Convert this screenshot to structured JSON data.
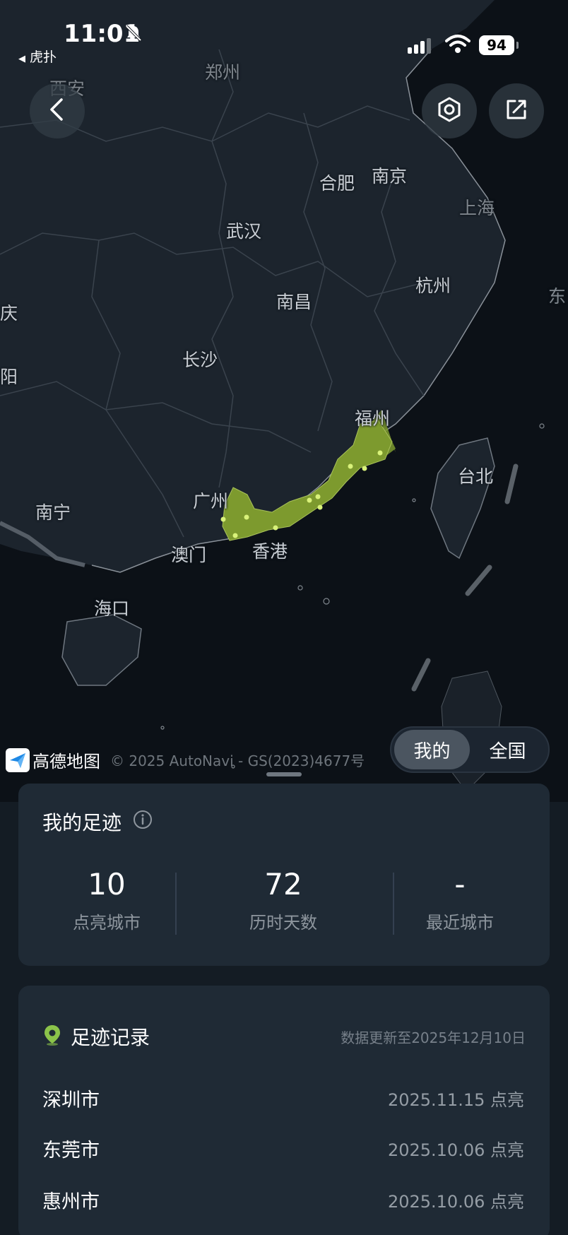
{
  "status_bar": {
    "time": "11:01",
    "back_app": "虎扑",
    "battery": "94"
  },
  "map": {
    "cities": [
      "郑州",
      "西安",
      "合肥",
      "南京",
      "上海",
      "武汉",
      "杭州",
      "南昌",
      "长沙",
      "福州",
      "台北",
      "广州",
      "南宁",
      "澳门",
      "香港",
      "海口",
      "阳",
      "庆",
      "东"
    ]
  },
  "toggle": {
    "mine": "我的",
    "national": "全国",
    "selected": "我的"
  },
  "attribution": {
    "brand": "高德地图",
    "copyright": "© 2025 AutoNavi - GS(2023)4677号"
  },
  "stats": {
    "title": "我的足迹",
    "items": [
      {
        "value": "10",
        "label": "点亮城市"
      },
      {
        "value": "72",
        "label": "历时天数"
      },
      {
        "value": "-",
        "label": "最近城市"
      }
    ]
  },
  "records": {
    "title": "足迹记录",
    "updated": "数据更新至2025年12月10日",
    "rows": [
      {
        "city": "深圳市",
        "date": "2025.11.15 点亮"
      },
      {
        "city": "东莞市",
        "date": "2025.10.06 点亮"
      },
      {
        "city": "惠州市",
        "date": "2025.10.06 点亮"
      }
    ]
  },
  "colors": {
    "highlight": "#7d9a2e",
    "dot": "#d9f27a",
    "accent_green": "#8bc34a"
  }
}
